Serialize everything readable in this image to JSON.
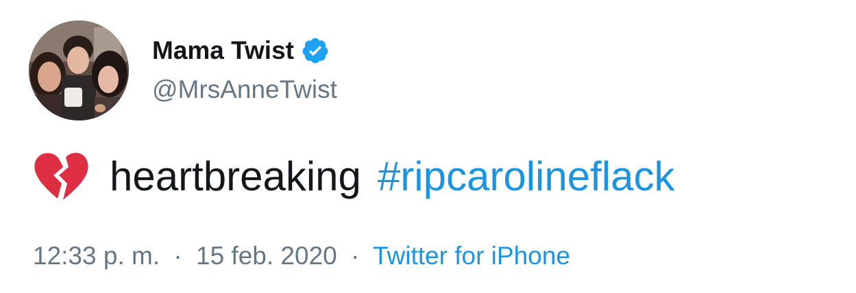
{
  "user": {
    "display_name": "Mama Twist",
    "handle": "@MrsAnneTwist",
    "verified": true,
    "avatar_icon": "profile-photo"
  },
  "tweet": {
    "emoji_icon": "broken-heart-icon",
    "text": "heartbreaking",
    "hashtag": "#ripcarolineflack"
  },
  "meta": {
    "time": "12:33 p. m.",
    "separator": "·",
    "date": "15 feb. 2020",
    "source": "Twitter for iPhone"
  },
  "colors": {
    "text": "#14171a",
    "secondary": "#657786",
    "link": "#1b95e0",
    "verified": "#1da1f2",
    "heart": "#dd2e44"
  }
}
